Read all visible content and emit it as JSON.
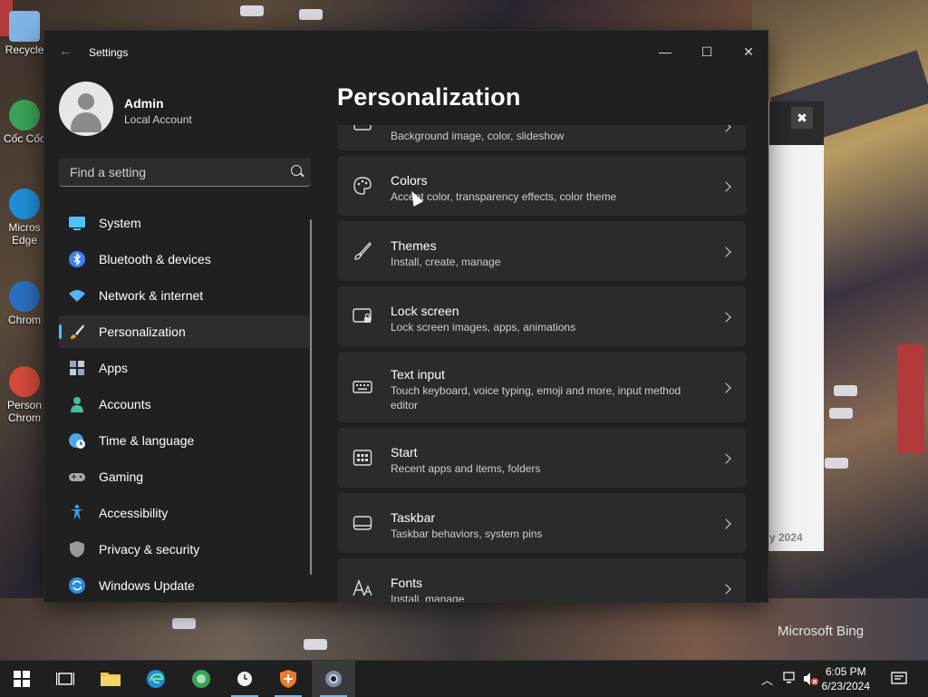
{
  "desktop": {
    "icons": [
      {
        "label": "Recycle",
        "color": "#7fb4e6"
      },
      {
        "label": "Cốc Cốc",
        "color": "#3ba35a"
      },
      {
        "label": "Micros Edge",
        "color": "#1e8fd8"
      },
      {
        "label": "Chrom",
        "color": "#2b6fbf"
      },
      {
        "label": "Person Chrom",
        "color": "#d64a3a"
      }
    ],
    "background_window": {
      "close_glyph": "✖",
      "year_text": "y 2024"
    },
    "watermark": "Microsoft Bing"
  },
  "settings": {
    "title": "Settings",
    "back_glyph": "←",
    "controls": {
      "minimize": "—",
      "maximize": "☐",
      "close": "✕"
    },
    "profile": {
      "name": "Admin",
      "account_type": "Local Account"
    },
    "search": {
      "placeholder": "Find a setting"
    },
    "nav": [
      {
        "label": "System",
        "icon": "monitor-icon",
        "color": "#4cc2ff",
        "active": false
      },
      {
        "label": "Bluetooth & devices",
        "icon": "bluetooth-icon",
        "color": "#3b82f6",
        "active": false
      },
      {
        "label": "Network & internet",
        "icon": "wifi-icon",
        "color": "#5ab0f5",
        "active": false
      },
      {
        "label": "Personalization",
        "icon": "brush-icon",
        "color": "#e59a42",
        "active": true
      },
      {
        "label": "Apps",
        "icon": "apps-icon",
        "color": "#9aa7b8",
        "active": false
      },
      {
        "label": "Accounts",
        "icon": "person-icon",
        "color": "#3fc2a0",
        "active": false
      },
      {
        "label": "Time & language",
        "icon": "globe-clock-icon",
        "color": "#4ca6e8",
        "active": false
      },
      {
        "label": "Gaming",
        "icon": "gamepad-icon",
        "color": "#a8a8a8",
        "active": false
      },
      {
        "label": "Accessibility",
        "icon": "accessibility-icon",
        "color": "#3b9cf0",
        "active": false
      },
      {
        "label": "Privacy & security",
        "icon": "shield-icon",
        "color": "#9a9a9a",
        "active": false
      },
      {
        "label": "Windows Update",
        "icon": "update-icon",
        "color": "#2e8be0",
        "active": false
      }
    ],
    "page_title": "Personalization",
    "cards": [
      {
        "title": "",
        "desc": "Background image, color, slideshow",
        "icon": "image-icon"
      },
      {
        "title": "Colors",
        "desc": "Accent color, transparency effects, color theme",
        "icon": "palette-icon"
      },
      {
        "title": "Themes",
        "desc": "Install, create, manage",
        "icon": "brush-icon"
      },
      {
        "title": "Lock screen",
        "desc": "Lock screen images, apps, animations",
        "icon": "lock-screen-icon"
      },
      {
        "title": "Text input",
        "desc": "Touch keyboard, voice typing, emoji and more, input method editor",
        "icon": "keyboard-icon"
      },
      {
        "title": "Start",
        "desc": "Recent apps and items, folders",
        "icon": "start-icon"
      },
      {
        "title": "Taskbar",
        "desc": "Taskbar behaviors, system pins",
        "icon": "taskbar-icon"
      },
      {
        "title": "Fonts",
        "desc": "Install, manage",
        "icon": "fonts-icon"
      }
    ]
  },
  "taskbar": {
    "apps": [
      "start-icon",
      "task-view-icon",
      "file-explorer-icon",
      "edge-icon",
      "coccoc-icon",
      "clock-app-icon",
      "security-app-icon",
      "settings-app-icon"
    ],
    "time": "6:05 PM",
    "date": "6/23/2024"
  }
}
